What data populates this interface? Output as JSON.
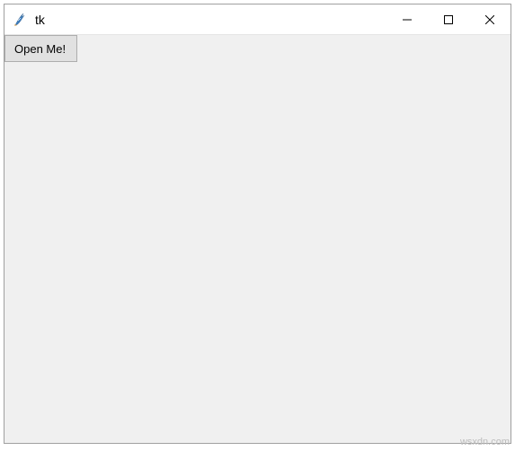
{
  "window": {
    "title": "tk",
    "icon_name": "tk-feather-icon"
  },
  "titlebar": {
    "minimize_label": "Minimize",
    "maximize_label": "Maximize",
    "close_label": "Close"
  },
  "content": {
    "open_button_label": "Open Me!"
  },
  "watermark": "wsxdn.com"
}
